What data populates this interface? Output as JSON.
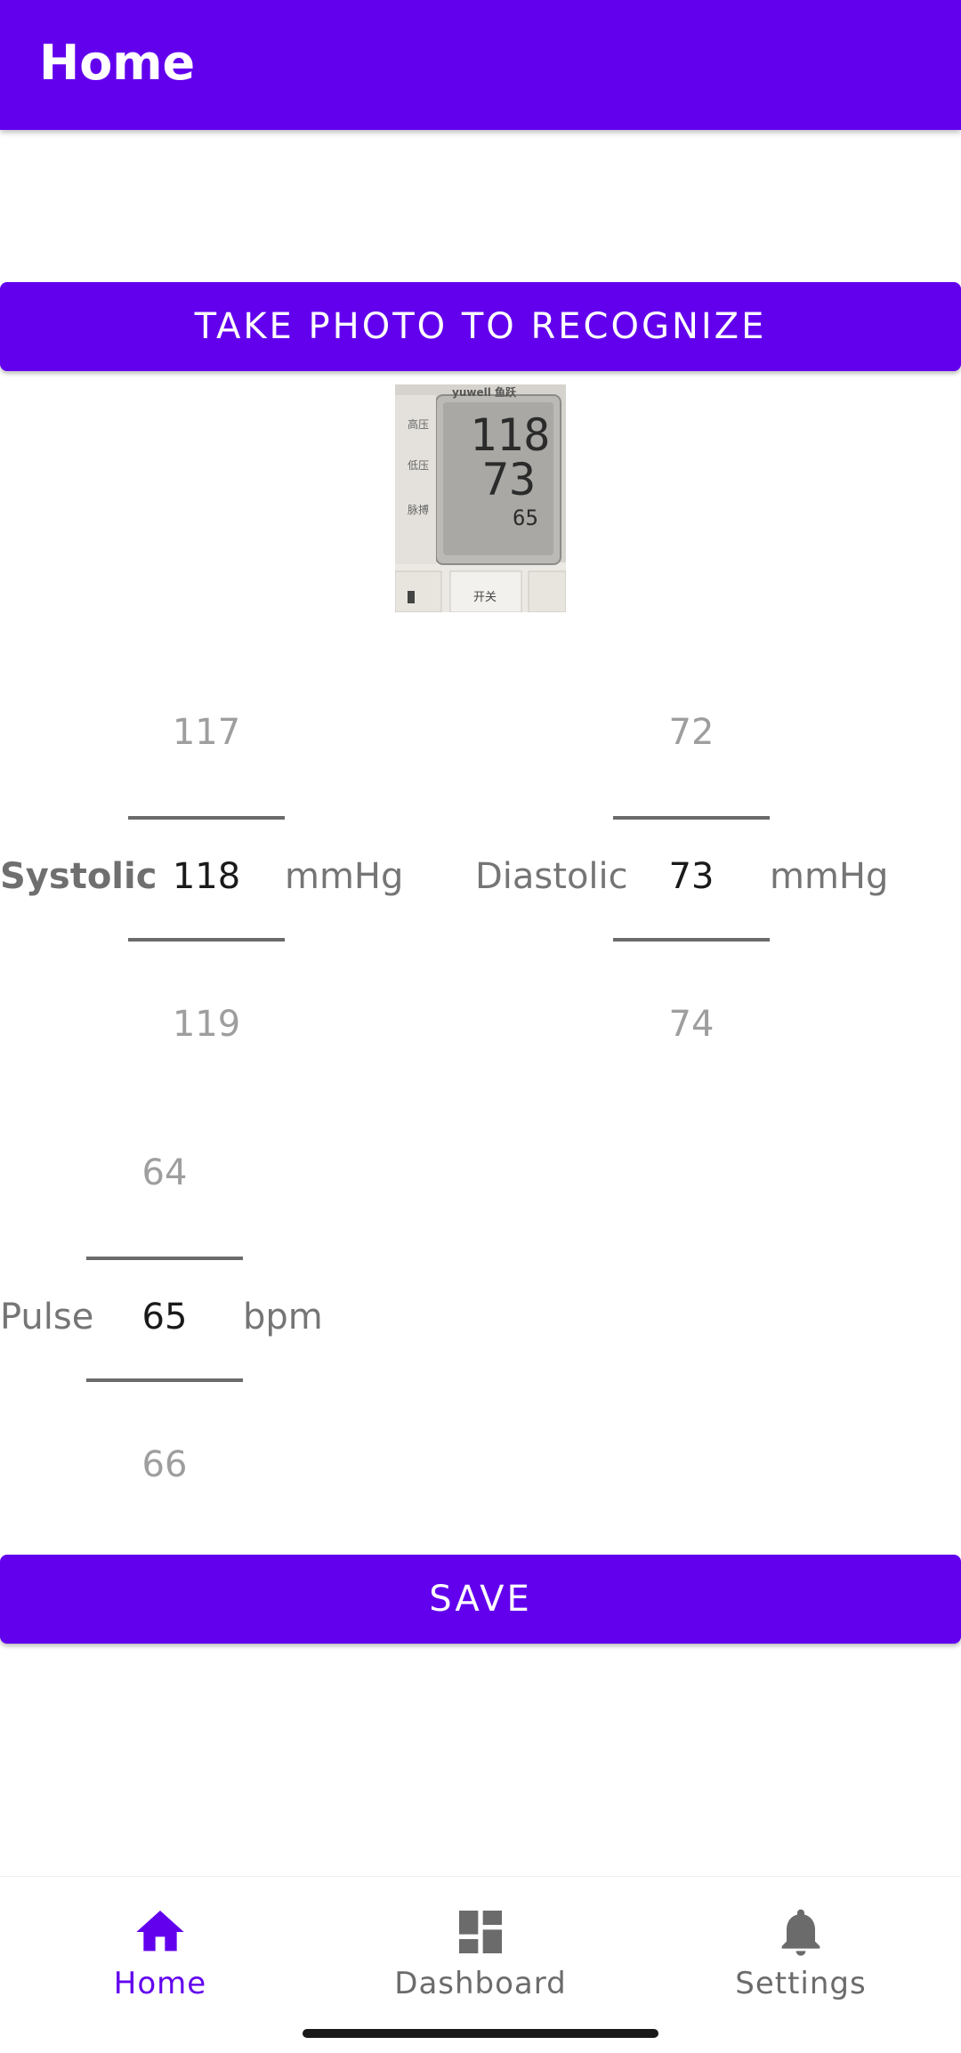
{
  "appbar": {
    "title": "Home"
  },
  "buttons": {
    "take_photo": "TAKE PHOTO TO RECOGNIZE",
    "save": "SAVE"
  },
  "photo": {
    "caption": "blood pressure monitor photo",
    "brand": "yuwell 鱼跃",
    "display_values": [
      "118",
      "73",
      "65"
    ],
    "side_labels": [
      "高压",
      "低压",
      "脉搏"
    ],
    "power_label": "开关"
  },
  "systolic": {
    "label": "Systolic",
    "prev": "117",
    "value": "118",
    "next": "119",
    "unit": "mmHg"
  },
  "diastolic": {
    "label": "Diastolic",
    "prev": "72",
    "value": "73",
    "next": "74",
    "unit": "mmHg"
  },
  "pulse": {
    "label": "Pulse",
    "prev": "64",
    "value": "65",
    "next": "66",
    "unit": "bpm"
  },
  "nav": {
    "items": [
      {
        "label": "Home",
        "icon": "home-icon",
        "active": true
      },
      {
        "label": "Dashboard",
        "icon": "dashboard-icon",
        "active": false
      },
      {
        "label": "Settings",
        "icon": "bell-icon",
        "active": false
      }
    ]
  },
  "colors": {
    "primary": "#6200EE",
    "text_muted": "#757575",
    "faint": "#9e9e9e"
  }
}
